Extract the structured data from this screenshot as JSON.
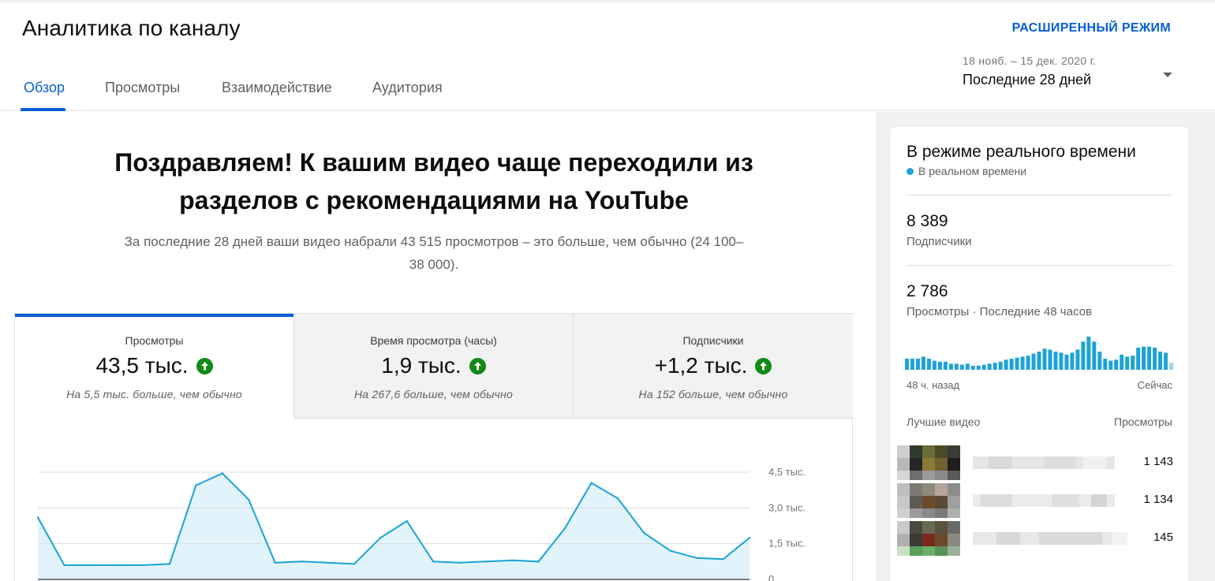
{
  "header": {
    "title": "Аналитика по каналу",
    "advanced_mode": "РАСШИРЕННЫЙ РЕЖИМ"
  },
  "tabs": [
    {
      "label": "Обзор",
      "active": true
    },
    {
      "label": "Просмотры",
      "active": false
    },
    {
      "label": "Взаимодействие",
      "active": false
    },
    {
      "label": "Аудитория",
      "active": false
    }
  ],
  "date_picker": {
    "range": "18 нояб. – 15 дек. 2020 г.",
    "label": "Последние 28 дней"
  },
  "summary": {
    "headline_line1": "Поздравляем! К вашим видео чаще переходили из",
    "headline_line2": "разделов с рекомендациями на YouTube",
    "subtext_line1": "За последние 28 дней ваши видео набрали 43 515 просмотров – это больше, чем обычно (24 100–",
    "subtext_line2": "38 000)."
  },
  "metrics": [
    {
      "label": "Просмотры",
      "value": "43,5 тыс.",
      "note": "На 5,5 тыс. больше, чем обычно",
      "active": true
    },
    {
      "label": "Время просмотра (часы)",
      "value": "1,9 тыс.",
      "note": "На 267,6 больше, чем обычно",
      "active": false
    },
    {
      "label": "Подписчики",
      "value": "+1,2 тыс.",
      "note": "На 152 больше, чем обычно",
      "active": false
    }
  ],
  "icons": {
    "metric_trend": "arrow-up-circle-icon",
    "dropdown": "caret-down-icon",
    "live": "live-dot-icon"
  },
  "colors": {
    "accent": "#065fd4",
    "line": "#1aa3d6",
    "area": "#e2f4fb",
    "trend_up": "#0f8a16",
    "live": "#1da3d6",
    "spark_bar": "#1da3d6"
  },
  "chart_data": {
    "type": "area",
    "series": [
      {
        "values": [
          2600,
          600,
          600,
          600,
          600,
          650,
          3950,
          4450,
          3350,
          700,
          750,
          700,
          650,
          1750,
          2450,
          750,
          700,
          750,
          800,
          750,
          2150,
          4050,
          3400,
          1950,
          1200,
          900,
          850,
          1750
        ]
      }
    ],
    "yticks": [
      "4,5 тыс.",
      "3,0 тыс.",
      "1,5 тыс.",
      "0"
    ],
    "ytick_values": [
      4500,
      3000,
      1500,
      0
    ],
    "ylim": [
      0,
      4500
    ]
  },
  "realtime": {
    "title": "В режиме реального времени",
    "live_label": "В реальном времени",
    "subscribers_value": "8 389",
    "subscribers_label": "Подписчики",
    "views_value": "2 786",
    "views_label": "Просмотры · Последние 48 часов",
    "spark_left": "48 ч. назад",
    "spark_right": "Сейчас",
    "hourly_views": [
      11,
      11,
      11,
      13,
      11,
      9,
      8,
      8,
      6,
      6,
      5,
      6,
      4,
      4,
      5,
      6,
      7,
      8,
      10,
      11,
      12,
      13,
      14,
      16,
      18,
      21,
      20,
      18,
      17,
      15,
      17,
      20,
      28,
      33,
      28,
      18,
      11,
      9,
      10,
      15,
      13,
      14,
      22,
      23,
      23,
      22,
      18,
      17,
      7
    ],
    "top_videos_label": "Лучшие видео",
    "top_views_label": "Просмотры",
    "top_videos": [
      {
        "views": "1 143"
      },
      {
        "views": "1 134"
      },
      {
        "views": "145"
      }
    ]
  }
}
